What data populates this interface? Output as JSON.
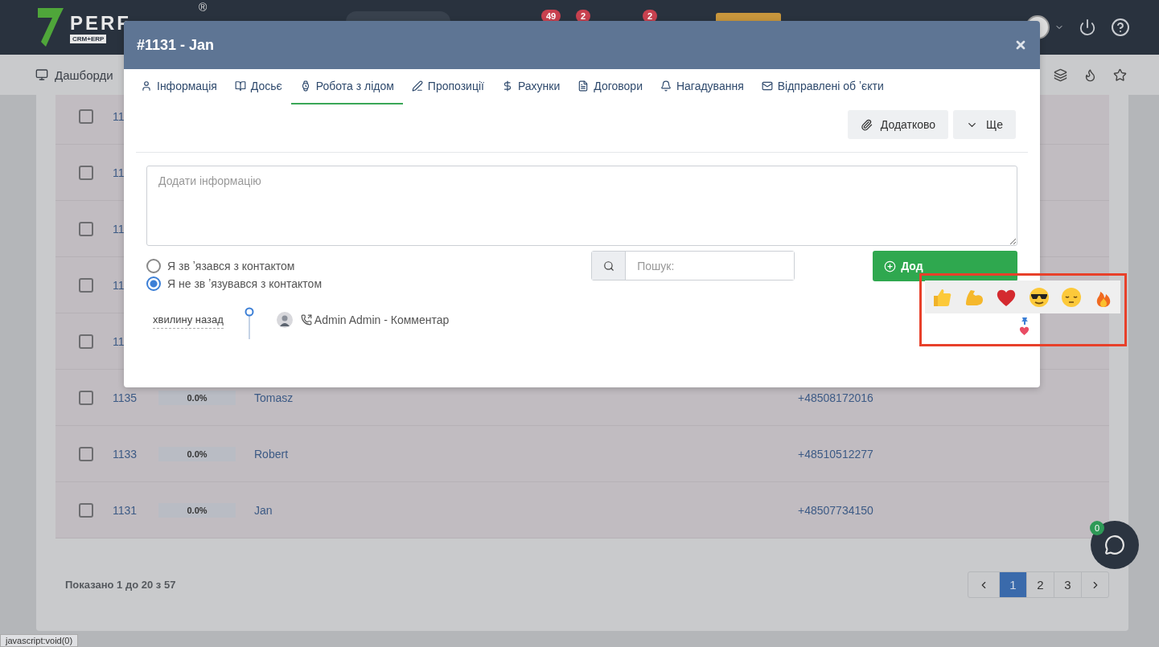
{
  "header": {
    "logo_text": "PERF",
    "logo_mark": "®",
    "logo_sub": "CRM+ERP",
    "badges": [
      "49",
      "2",
      "2"
    ]
  },
  "nav": {
    "label": "Дашборди"
  },
  "table": {
    "rows": [
      {
        "id": "11",
        "checked": false
      },
      {
        "id": "11",
        "checked": false
      },
      {
        "id": "11",
        "checked": false
      },
      {
        "id": "11",
        "checked": false
      },
      {
        "id": "11",
        "checked": false
      },
      {
        "id": "1135",
        "progress": "0.0%",
        "name": "Tomasz",
        "phone": "+48508172016",
        "checked": false
      },
      {
        "id": "1133",
        "progress": "0.0%",
        "name": "Robert",
        "phone": "+48510512277",
        "checked": false
      },
      {
        "id": "1131",
        "progress": "0.0%",
        "name": "Jan",
        "phone": "+48507734150",
        "checked": false
      }
    ]
  },
  "footer": {
    "summary": "Показано 1 до 20 з 57",
    "pages": [
      {
        "label": "1",
        "selected": true
      },
      {
        "label": "2",
        "selected": false
      },
      {
        "label": "3",
        "selected": false
      }
    ]
  },
  "modal": {
    "title": "#1131 - Jan",
    "tabs": [
      {
        "label": "Інформація",
        "selected": false
      },
      {
        "label": "Досьє",
        "selected": false
      },
      {
        "label": "Робота з лідом",
        "selected": true
      },
      {
        "label": "Пропозиції",
        "selected": false
      },
      {
        "label": "Рахунки",
        "selected": false
      },
      {
        "label": "Договори",
        "selected": false
      },
      {
        "label": "Нагадування",
        "selected": false
      },
      {
        "label": "Відправлені об ʼєкти",
        "selected": false
      }
    ],
    "actions": [
      "Додатково",
      "Ще"
    ],
    "note": {
      "placeholder": "Додати інформацію"
    },
    "radios": [
      {
        "label": "Я зв ʼязався з контактом",
        "selected": false
      },
      {
        "label": "Я не зв ʼязувався з контактом",
        "selected": true
      }
    ],
    "search": {
      "placeholder": "Пошук:"
    },
    "add_button": "Дод",
    "timeline": [
      {
        "time": "хвилину назад",
        "text": "Admin Admin - Комментар"
      }
    ]
  },
  "chat": {
    "badge": "0"
  },
  "status_bar": "javascript:void(0)"
}
